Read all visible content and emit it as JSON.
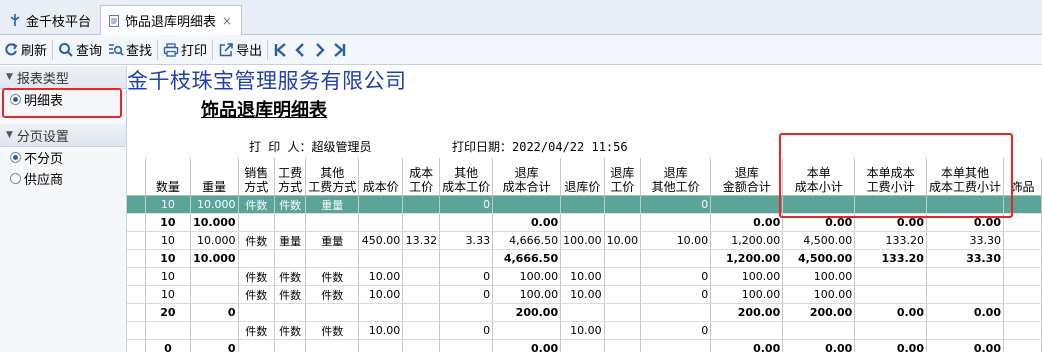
{
  "tabs": [
    {
      "label": "金千枝平台",
      "icon": "platform-icon"
    },
    {
      "label": "饰品退库明细表",
      "icon": "document-icon",
      "close": "×"
    }
  ],
  "toolbar": {
    "refresh": "刷新",
    "query": "查询",
    "find": "查找",
    "print": "打印",
    "export": "导出"
  },
  "sidebar": {
    "report_type": {
      "title": "报表类型",
      "options": [
        "明细表"
      ]
    },
    "paging": {
      "title": "分页设置",
      "options": [
        "不分页",
        "供应商"
      ]
    }
  },
  "report": {
    "company": "金千枝珠宝管理服务有限公司",
    "title": "饰品退库明细表",
    "printer": "打 印 人：超级管理员",
    "print_date": "打印日期：2022/04/22 11:56",
    "columns": [
      "数量",
      "重量",
      "销售\n方式",
      "工费\n方式",
      "其他\n工费方式",
      "成本价",
      "成本\n工价",
      "其他\n成本工价",
      "退库\n成本合计",
      "退库价",
      "退库\n工价",
      "退库\n其他工价",
      "退库\n金额合计",
      "本单\n成本小计",
      "本单成本\n工费小计",
      "本单其他\n成本工费小计",
      "饰品"
    ],
    "rows": [
      {
        "cells": [
          "10",
          "10.000",
          "件数",
          "件数",
          "重量",
          "",
          "",
          "0",
          "",
          "",
          "",
          "0",
          "",
          "",
          "",
          "",
          ""
        ],
        "sel": true
      },
      {
        "cells": [
          "10",
          "10.000",
          "",
          "",
          "",
          "",
          "",
          "",
          "0.00",
          "",
          "",
          "",
          "0.00",
          "0.00",
          "0.00",
          "0.00",
          ""
        ],
        "bold": true
      },
      {
        "cells": [
          "10",
          "10.000",
          "件数",
          "重量",
          "重量",
          "450.00",
          "13.32",
          "3.33",
          "4,666.50",
          "100.00",
          "10.00",
          "10.00",
          "1,200.00",
          "4,500.00",
          "133.20",
          "33.30",
          ""
        ]
      },
      {
        "cells": [
          "10",
          "10.000",
          "",
          "",
          "",
          "",
          "",
          "",
          "4,666.50",
          "",
          "",
          "",
          "1,200.00",
          "4,500.00",
          "133.20",
          "33.30",
          ""
        ],
        "bold": true
      },
      {
        "cells": [
          "10",
          "",
          "件数",
          "件数",
          "件数",
          "10.00",
          "",
          "0",
          "100.00",
          "10.00",
          "",
          "0",
          "100.00",
          "100.00",
          "",
          "",
          ""
        ]
      },
      {
        "cells": [
          "10",
          "",
          "件数",
          "件数",
          "件数",
          "10.00",
          "",
          "0",
          "100.00",
          "10.00",
          "",
          "0",
          "100.00",
          "100.00",
          "",
          "",
          ""
        ]
      },
      {
        "cells": [
          "20",
          "0",
          "",
          "",
          "",
          "",
          "",
          "",
          "200.00",
          "",
          "",
          "",
          "200.00",
          "200.00",
          "0.00",
          "0.00",
          ""
        ],
        "bold": true
      },
      {
        "cells": [
          "",
          "",
          "件数",
          "件数",
          "件数",
          "10.00",
          "",
          "0",
          "",
          "10.00",
          "",
          "0",
          "",
          "",
          "",
          "",
          ""
        ]
      },
      {
        "cells": [
          "0",
          "0",
          "",
          "",
          "",
          "",
          "",
          "",
          "0.00",
          "",
          "",
          "",
          "0.00",
          "0.00",
          "0.00",
          "0.00",
          ""
        ],
        "bold": true
      }
    ]
  },
  "colors": {
    "accent_red": "#e8262a",
    "selected_row": "#5aa598",
    "company_blue": "#1f3fb5"
  }
}
